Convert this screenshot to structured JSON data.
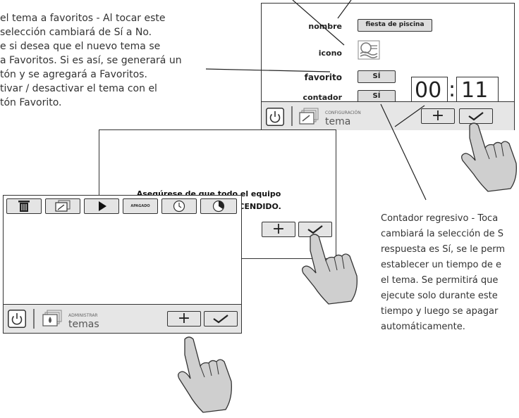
{
  "annotations": {
    "favorite_note": [
      "el tema a favoritos - Al tocar este",
      "selección cambiará de Sí a No.",
      "e si desea que el nuevo tema se",
      "a Favoritos. Si es así, se generará un",
      "tón y se agregará a Favoritos.",
      "tivar / desactivar el tema con el",
      "tón Favorito."
    ],
    "countdown_note": [
      "Contador regresivo - Toca",
      "cambiará la selección de S",
      "respuesta es Sí, se le perm",
      "establecer un tiempo de e",
      "el tema. Se permitirá que",
      "ejecute solo durante este",
      "tiempo y luego se apagar",
      "automáticamente."
    ]
  },
  "config_screen": {
    "name_label": "nombre",
    "name_value": "fiesta de piscina",
    "icon_label": "icono",
    "favorite_label": "favorito",
    "favorite_value": "SÍ",
    "countdown_label": "contador regresivo",
    "countdown_value": "SÍ",
    "timer_hours": "00",
    "timer_sep": ":",
    "timer_minutes": "11",
    "section_small": "CONFIGURACIÓN",
    "section_big": "tema",
    "add_symbol": "+",
    "confirm_symbol": "✓"
  },
  "confirm_dialog": {
    "message_line1": "Asegúrese de que todo el equipo",
    "message_line2": "para este tema esté ENCENDIDO.",
    "add_symbol": "+"
  },
  "manage_screen": {
    "off_label": "APAGADO",
    "section_small": "ADMINISTRAR",
    "section_big": "temas",
    "add_symbol": "+"
  },
  "colors": {
    "frame": "#333333",
    "button_fill": "#e4e4e4",
    "bar_fill": "#e6e6e6",
    "hand_fill": "#cfcfcf"
  }
}
